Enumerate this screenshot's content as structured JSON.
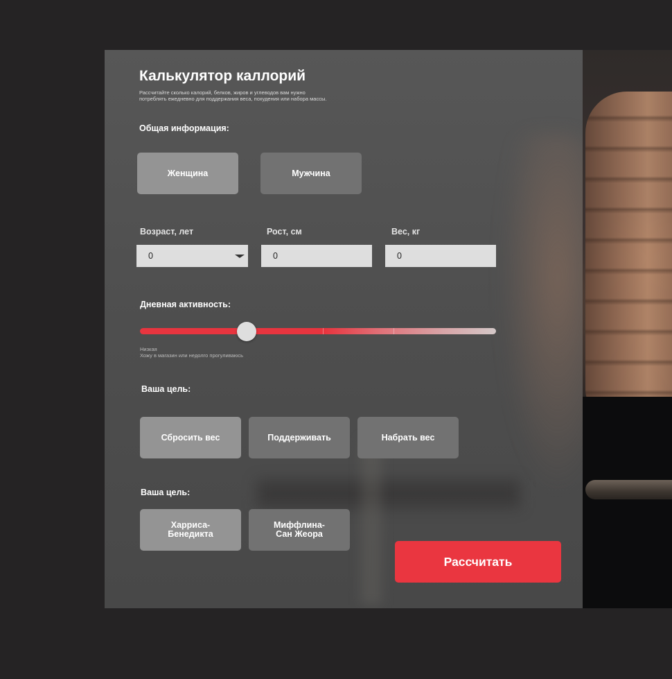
{
  "calculator": {
    "title": "Калькулятор каллорий",
    "subtitle_line1": "Рассчитайте сколько калорий, белков, жиров и углеводов вам нужно",
    "subtitle_line2": "потреблять ежедневно для поддержания веса, похудения или набора массы."
  },
  "general": {
    "label": "Общая информация:",
    "gender_options": [
      "Женщина",
      "Мужчина"
    ],
    "selected_gender": "Женщина"
  },
  "fields": {
    "age": {
      "label": "Возраст, лет",
      "value": "0"
    },
    "height": {
      "label": "Рост, см",
      "value": "0"
    },
    "weight": {
      "label": "Вес, кг",
      "value": "0"
    }
  },
  "activity": {
    "label": "Дневная активность:",
    "level": 0.3,
    "level_name": "Низкая",
    "level_description": "Хожу в магазин или недолго прогуливаюсь"
  },
  "goal": {
    "label": "Ваша цель:",
    "options": [
      "Сбросить вес",
      "Поддерживать",
      "Набрать вес"
    ],
    "selected": "Сбросить вес"
  },
  "formula": {
    "label": "Ваша цель:",
    "options": [
      {
        "line1": "Харриса-",
        "line2": "Бенедикта"
      },
      {
        "line1": "Миффлина-",
        "line2": "Сан Жеора"
      }
    ],
    "selected_index": 0
  },
  "action": {
    "calculate_label": "Рассчитать"
  },
  "colors": {
    "accent": "#ea3640",
    "panel": "#525252",
    "button_active": "#949494",
    "button_inactive": "#727272",
    "page_bg": "#252324"
  }
}
